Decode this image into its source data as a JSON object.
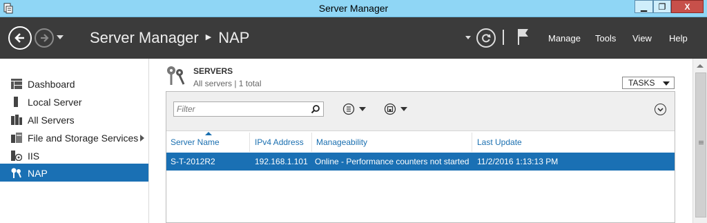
{
  "window": {
    "title": "Server Manager",
    "minimize_icon": "minimize-icon",
    "restore_icon": "restore-icon",
    "close_icon": "close-icon",
    "minimize_glyph": "▁",
    "restore_glyph": "❐",
    "close_glyph": "X"
  },
  "header": {
    "breadcrumb_root": "Server Manager",
    "breadcrumb_sep": "▶",
    "breadcrumb_current": "NAP",
    "menu": [
      "Manage",
      "Tools",
      "View",
      "Help"
    ]
  },
  "sidebar": {
    "items": [
      {
        "label": "Dashboard",
        "icon": "dashboard-icon",
        "active": false
      },
      {
        "label": "Local Server",
        "icon": "server-icon",
        "active": false
      },
      {
        "label": "All Servers",
        "icon": "servers-icon",
        "active": false
      },
      {
        "label": "File and Storage Services",
        "icon": "storage-icon",
        "active": false,
        "has_arrow": true
      },
      {
        "label": "IIS",
        "icon": "iis-icon",
        "active": false
      },
      {
        "label": "NAP",
        "icon": "nap-key-icon",
        "active": true
      }
    ]
  },
  "servers": {
    "title": "SERVERS",
    "subtitle": "All servers | 1 total",
    "tasks_label": "TASKS",
    "filter_placeholder": "Filter",
    "columns": [
      "Server Name",
      "IPv4 Address",
      "Manageability",
      "Last Update"
    ],
    "rows": [
      {
        "name": "S-T-2012R2",
        "ipv4": "192.168.1.101",
        "manageability": "Online - Performance counters not started",
        "last_update": "11/2/2016 1:13:13 PM",
        "selected": true
      }
    ]
  },
  "colors": {
    "titlebar": "#8fd6f5",
    "header": "#3b3b3b",
    "selection": "#1a70b4",
    "link": "#1a6fb0",
    "close_button": "#c7504a"
  }
}
